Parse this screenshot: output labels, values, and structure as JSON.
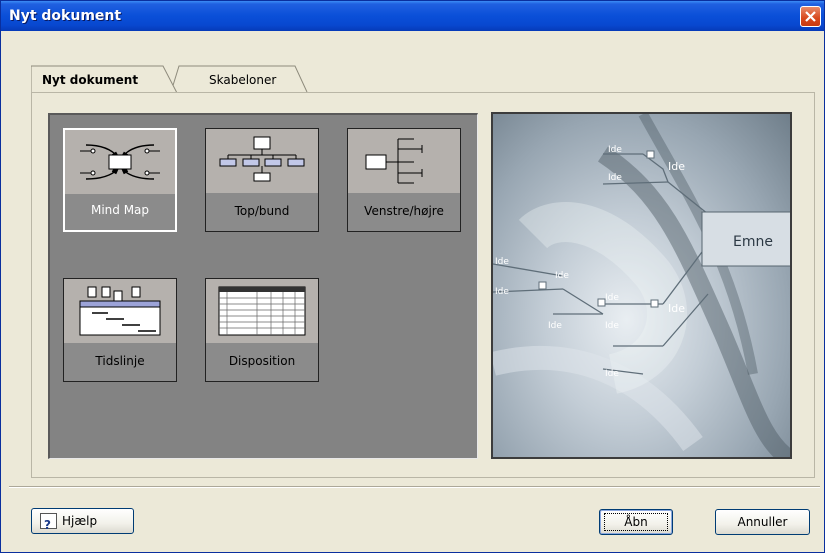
{
  "window": {
    "title": "Nyt dokument"
  },
  "tabs": [
    {
      "label": "Nyt dokument",
      "active": true
    },
    {
      "label": "Skabeloner",
      "active": false
    }
  ],
  "templates": [
    {
      "label": "Mind Map",
      "icon": "mind-map-icon",
      "selected": true
    },
    {
      "label": "Top/bund",
      "icon": "org-chart-icon",
      "selected": false
    },
    {
      "label": "Venstre/højre",
      "icon": "tree-right-icon",
      "selected": false
    },
    {
      "label": "Tidslinje",
      "icon": "timeline-icon",
      "selected": false
    },
    {
      "label": "Disposition",
      "icon": "outline-table-icon",
      "selected": false
    }
  ],
  "preview": {
    "central_topic": "Emne",
    "idea_labels": [
      "Ide",
      "Ide",
      "Ide",
      "Ide",
      "Ide",
      "Ide",
      "Ide",
      "Ide",
      "Ide",
      "Ide",
      "Ide"
    ]
  },
  "buttons": {
    "help": "Hjælp",
    "open": "Åbn",
    "cancel": "Annuller"
  },
  "colors": {
    "titlebar": "#0a4fd8",
    "dialog_bg": "#ece9d8",
    "tile_area_bg": "#838383",
    "close_button": "#d8481c"
  }
}
